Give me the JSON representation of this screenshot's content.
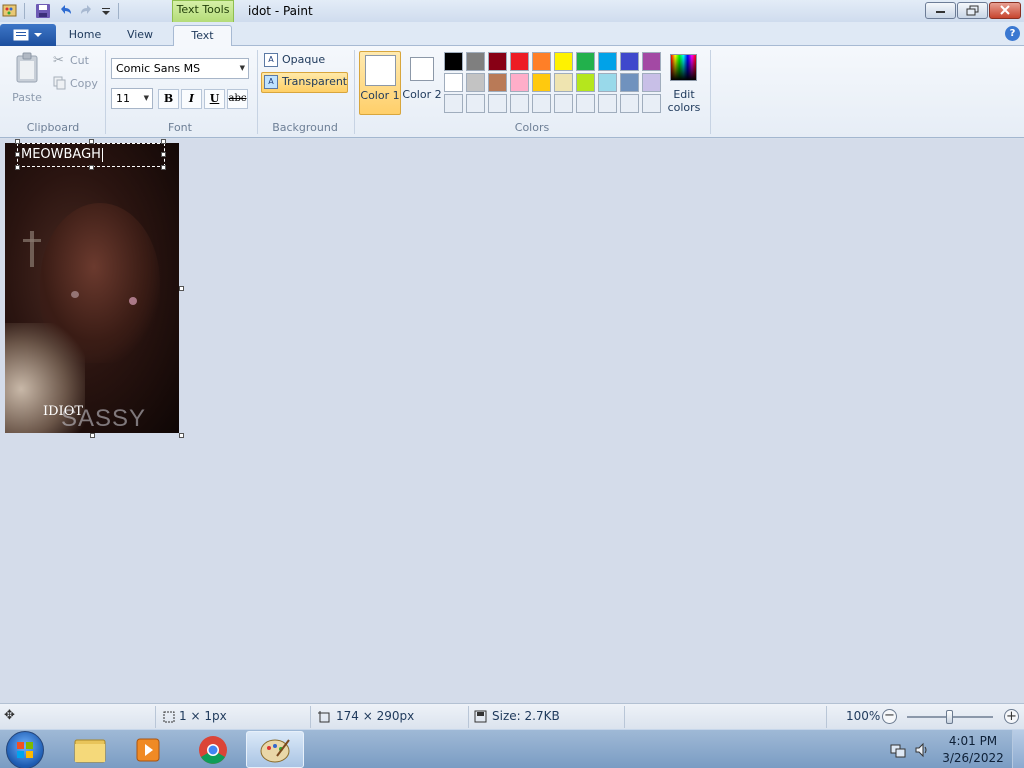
{
  "window": {
    "title": "idot - Paint",
    "contextual_tab": "Text Tools"
  },
  "tabs": {
    "home": "Home",
    "view": "View",
    "text": "Text"
  },
  "clipboard": {
    "paste": "Paste",
    "cut": "Cut",
    "copy": "Copy",
    "group_label": "Clipboard"
  },
  "font": {
    "family": "Comic Sans MS",
    "size": "11",
    "bold": "B",
    "italic": "I",
    "underline": "U",
    "strike": "abc",
    "group_label": "Font"
  },
  "background": {
    "opaque": "Opaque",
    "transparent": "Transparent",
    "group_label": "Background"
  },
  "colors": {
    "color1_label": "Color 1",
    "color2_label": "Color 2",
    "edit_label": "Edit colors",
    "group_label": "Colors",
    "color1": "#ffffff",
    "color2": "#ffffff",
    "palette_row1": [
      "#000000",
      "#7f7f7f",
      "#880015",
      "#ed1c24",
      "#ff7f27",
      "#fff200",
      "#22b14c",
      "#00a2e8",
      "#3f48cc",
      "#a349a4"
    ],
    "palette_row2": [
      "#ffffff",
      "#c3c3c3",
      "#b97a57",
      "#ffaec9",
      "#ffc90e",
      "#efe4b0",
      "#b5e61d",
      "#99d9ea",
      "#7092be",
      "#c8bfe7"
    ],
    "palette_row3": [
      "#e8eef6",
      "#e8eef6",
      "#e8eef6",
      "#e8eef6",
      "#e8eef6",
      "#e8eef6",
      "#e8eef6",
      "#e8eef6",
      "#e8eef6",
      "#e8eef6"
    ]
  },
  "canvas": {
    "text_box_value": "MEOWBAGH",
    "image_text_1": "IDIOT",
    "image_text_2": "SASSY"
  },
  "status": {
    "selection": "1 × 1px",
    "dimensions": "174 × 290px",
    "size": "Size: 2.7KB",
    "zoom": "100%"
  },
  "taskbar": {
    "time": "4:01 PM",
    "date": "3/26/2022"
  }
}
